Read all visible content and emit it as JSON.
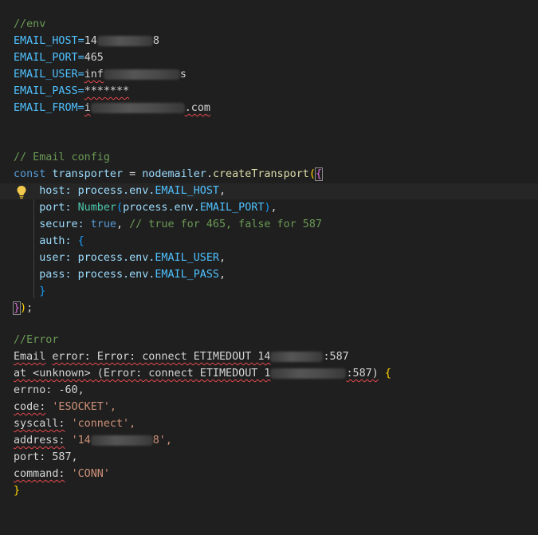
{
  "env_block": {
    "comment": "//env",
    "host_key": "EMAIL_HOST=",
    "host_visible_start": "14",
    "host_visible_end": "8",
    "port_key": "EMAIL_PORT=",
    "port_value": "465",
    "user_key": "EMAIL_USER=",
    "user_visible_start": "inf",
    "user_visible_end": "s",
    "pass_key": "EMAIL_PASS=",
    "pass_value": "*******",
    "from_key": "EMAIL_FROM=",
    "from_visible_start": "i",
    "from_visible_end": ".com"
  },
  "config_block": {
    "comment": "// Email config",
    "decl_kw": "const",
    "decl_name": "transporter",
    "assign": " = ",
    "obj": "nodemailer",
    "method": "createTransport",
    "host_label": "host:",
    "process_env": "process.env.",
    "host_env": "EMAIL_HOST",
    "port_label": "port:",
    "number_fn": "Number",
    "port_env": "EMAIL_PORT",
    "secure_label": "secure:",
    "secure_value": "true",
    "secure_comment": "// true for 465, false for 587",
    "auth_label": "auth:",
    "user_label": "user:",
    "user_env": "EMAIL_USER",
    "pass_label": "pass:",
    "pass_env": "EMAIL_PASS"
  },
  "error_block": {
    "comment": "//Error",
    "l1_email": "Email",
    "l1_rest": "error: Error: connect ETIMEDOUT 14",
    "l1_end": ":587",
    "l2_start": "at <unknown> (Error: connect ETIMEDOUT 1",
    "l2_end": ":587)",
    "errno_label": "errno:",
    "errno_value": "-60,",
    "code_label": "code:",
    "code_value": "'ESOCKET',",
    "syscall_label": "syscall:",
    "syscall_value": "'connect',",
    "address_label": "address:",
    "address_start": "'14",
    "address_end": "8',",
    "port_label": "port:",
    "port_value": "587,",
    "command_label": "command:",
    "command_value": "'CONN'",
    "close": "}"
  },
  "colors": {
    "background": "#1f1f1f",
    "comment": "#6a9955",
    "keyword": "#569cd6",
    "string": "#ce9178",
    "bracket": "#ffd700"
  }
}
